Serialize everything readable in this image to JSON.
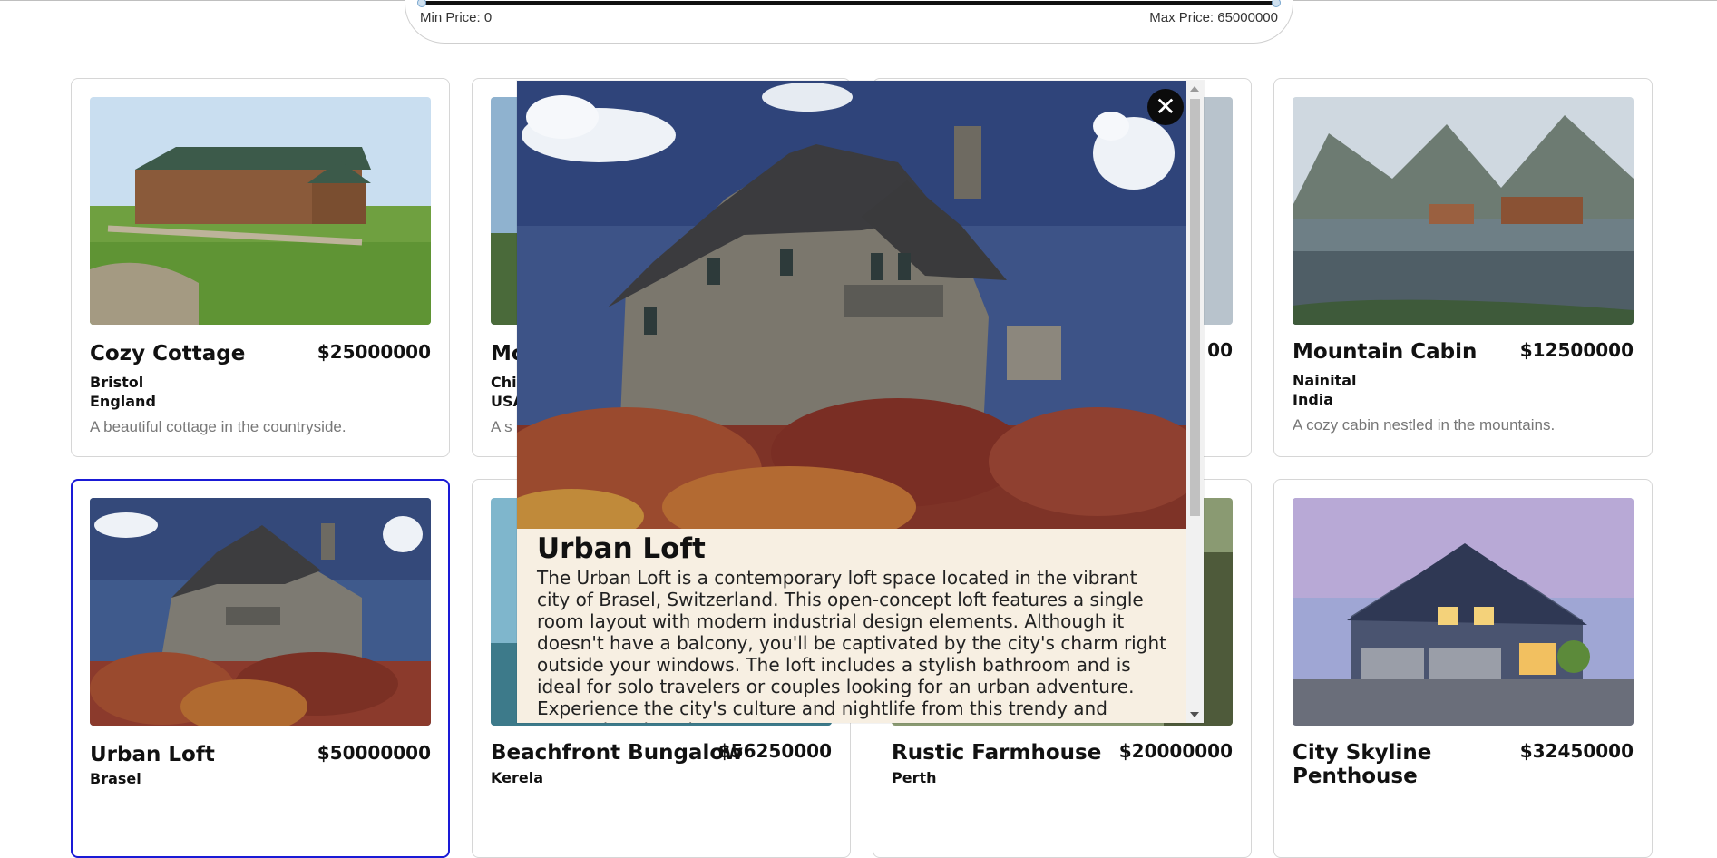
{
  "filter": {
    "min_label": "Min Price: 0",
    "max_label": "Max Price: 65000000"
  },
  "cards": [
    {
      "name": "Cozy Cottage",
      "price": "$25000000",
      "city": "Bristol",
      "country": "England",
      "description": "A beautiful cottage in the countryside."
    },
    {
      "name": "Mo",
      "city": "Chi",
      "country": "USA",
      "description": "A s"
    },
    {
      "name": "",
      "price": "00"
    },
    {
      "name": "Mountain Cabin",
      "price": "$12500000",
      "city": "Nainital",
      "country": "India",
      "description": "A cozy cabin nestled in the mountains."
    },
    {
      "name": "Urban Loft",
      "price": "$50000000",
      "city": "Brasel"
    },
    {
      "name": "Beachfront Bungalow",
      "price": "$56250000",
      "city": "Kerela"
    },
    {
      "name": "Rustic Farmhouse",
      "price": "$20000000",
      "city": "Perth"
    },
    {
      "name": "City Skyline Penthouse",
      "price": "$32450000"
    }
  ],
  "modal": {
    "title": "Urban Loft",
    "description": "The Urban Loft is a contemporary loft space located in the vibrant city of Brasel, Switzerland. This open-concept loft features a single room layout with modern industrial design elements. Although it doesn't have a balcony, you'll be captivated by the city's charm right outside your windows. The loft includes a stylish bathroom and is ideal for solo travelers or couples looking for an urban adventure. Experience the city's culture and nightlife from this trendy and convenient location. For",
    "close_icon": "close-icon",
    "close_glyph": "✕"
  },
  "colors": {
    "selected_border": "#1a1ad6",
    "modal_background": "#f7efe2"
  }
}
